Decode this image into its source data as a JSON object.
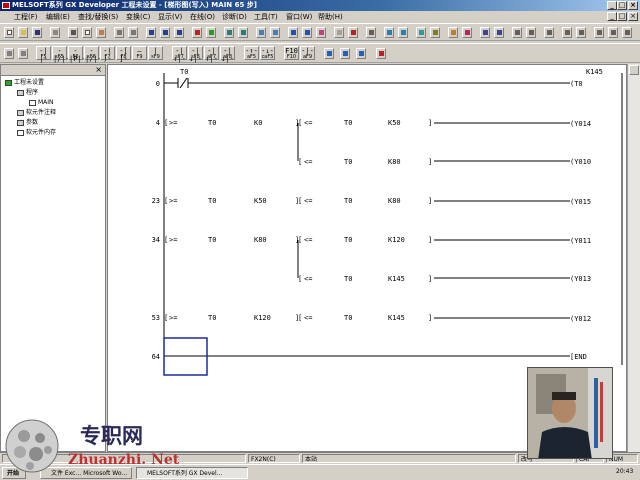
{
  "window": {
    "title": "MELSOFT系列 GX Developer 工程未设置 - [梯形图(写入)   MAIN   65 步]"
  },
  "menu": [
    "工程(F)",
    "编辑(E)",
    "查找/替换(S)",
    "变换(C)",
    "显示(V)",
    "在线(O)",
    "诊断(D)",
    "工具(T)",
    "窗口(W)",
    "帮助(H)"
  ],
  "fkeys": [
    {
      "sym": "-| |-",
      "key": "F5"
    },
    {
      "sym": "-|/|-",
      "key": "sF5"
    },
    {
      "sym": "-|P|-",
      "key": "F6"
    },
    {
      "sym": "-|/|-",
      "key": "sF6"
    },
    {
      "sym": "-( )-",
      "key": "F7"
    },
    {
      "sym": "-[ ]-",
      "key": "F8"
    },
    {
      "sym": "—",
      "key": "F9"
    },
    {
      "sym": "|",
      "key": "sF9"
    },
    {
      "sym": "-|↑|-",
      "key": "sF7"
    },
    {
      "sym": "-|↓|-",
      "key": "sF8"
    },
    {
      "sym": "-|↑|-",
      "key": "aF7"
    },
    {
      "sym": "-|↓|-",
      "key": "aF8"
    },
    {
      "sym": "-↑-",
      "key": "aF5"
    },
    {
      "sym": "-↓-",
      "key": "caF5"
    },
    {
      "sym": "F10",
      "key": "F10"
    },
    {
      "sym": "-|-",
      "key": "aF9"
    }
  ],
  "tree": {
    "root": "工程未设置",
    "program": "程序",
    "main": "MAIN",
    "comment": "软元件注释",
    "param": "参数",
    "devmem": "软元件内存"
  },
  "ladder": {
    "step0": "0",
    "step4": "4",
    "step23": "23",
    "step34": "34",
    "step53": "53",
    "step64": "64",
    "t0": "T0",
    "k145": "K145",
    "k0": "K0",
    "k50": "K50",
    "k80": "K80",
    "k120": "K120",
    "gte": ">=",
    "lte": "<=",
    "coil_t0": "(T0",
    "y014": "(Y014",
    "y010": "(Y010",
    "y015": "(Y015",
    "y011": "(Y011",
    "y013": "(Y013",
    "y012": "(Y012",
    "end": "[END"
  },
  "status": {
    "plc": "FX2N(C)",
    "station": "本站",
    "mode": "改写",
    "cap": "CAP",
    "num": "NUM"
  },
  "taskbar": {
    "start": "开始",
    "task1": "文件 Exc... Microsoft Wo...",
    "task2": "MELSOFT系列 GX Devel...",
    "clock": "20:43"
  },
  "watermark": {
    "cn": "专职网",
    "url": "Zhuanzhi. Net"
  }
}
